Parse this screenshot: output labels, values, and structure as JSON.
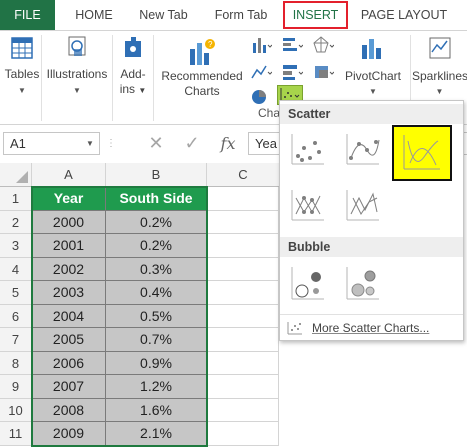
{
  "tabs": {
    "file": "FILE",
    "home": "HOME",
    "new_tab": "New Tab",
    "form_tab": "Form Tab",
    "insert": "INSERT",
    "page_layout": "PAGE LAYOUT"
  },
  "ribbon": {
    "tables": "Tables",
    "illustrations": "Illustrations",
    "addins_line1": "Add-",
    "addins_line2": "ins",
    "recommended_line1": "Recommended",
    "recommended_line2": "Charts",
    "charts_group_label": "Cha",
    "pivotchart": "PivotChart",
    "sparklines": "Sparklines"
  },
  "formula_bar": {
    "name_box": "A1",
    "cancel_glyph": "✕",
    "enter_glyph": "✓",
    "fx": "fx",
    "value": "Yea"
  },
  "sheet": {
    "columns": [
      "A",
      "B",
      "C"
    ],
    "rows": [
      "1",
      "2",
      "3",
      "4",
      "5",
      "6",
      "7",
      "8",
      "9",
      "10",
      "11"
    ],
    "headers": [
      "Year",
      "South Side"
    ],
    "data": [
      [
        "2000",
        "0.2%"
      ],
      [
        "2001",
        "0.2%"
      ],
      [
        "2002",
        "0.3%"
      ],
      [
        "2003",
        "0.4%"
      ],
      [
        "2004",
        "0.5%"
      ],
      [
        "2005",
        "0.7%"
      ],
      [
        "2006",
        "0.9%"
      ],
      [
        "2007",
        "1.2%"
      ],
      [
        "2008",
        "1.6%"
      ],
      [
        "2009",
        "2.1%"
      ]
    ]
  },
  "scatter_menu": {
    "scatter_heading": "Scatter",
    "bubble_heading": "Bubble",
    "more": "More Scatter Charts...",
    "highlighted_item": "scatter-with-smooth-lines"
  },
  "colors": {
    "excel_green": "#217346",
    "header_green": "#1f9b4e",
    "insert_outline": "#e3202c",
    "highlight_yellow": "#ffff00",
    "data_gray": "#c6c6c6"
  }
}
